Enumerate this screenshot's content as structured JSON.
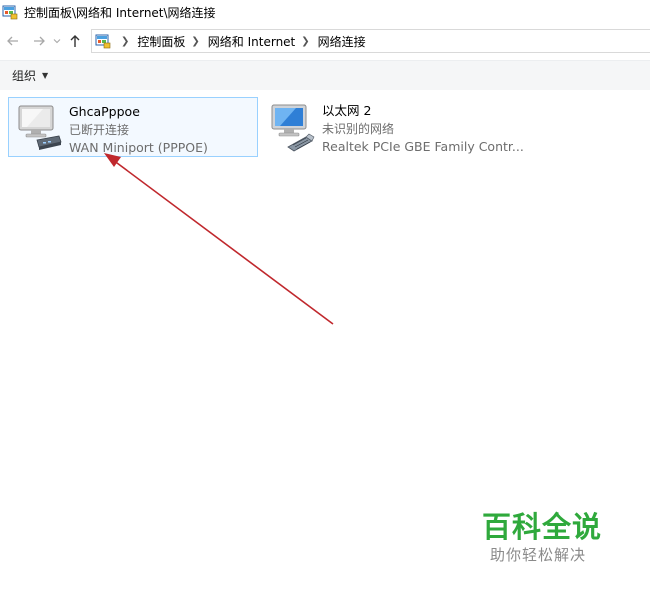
{
  "window": {
    "title": "控制面板\\网络和 Internet\\网络连接"
  },
  "nav": {
    "back_icon": "arrow-left-icon",
    "forward_icon": "arrow-right-icon",
    "recent_icon": "chevron-down-icon",
    "up_icon": "arrow-up-icon",
    "breadcrumbs": [
      "控制面板",
      "网络和 Internet",
      "网络连接"
    ]
  },
  "toolbar": {
    "organize_label": "组织"
  },
  "connections": [
    {
      "name": "GhcaPppoe",
      "status": "已断开连接",
      "device": "WAN Miniport (PPPOE)",
      "selected": true,
      "icon": "dialup-connection-icon"
    },
    {
      "name": "以太网 2",
      "status": "未识别的网络",
      "device": "Realtek PCIe GBE Family Contr...",
      "selected": false,
      "icon": "ethernet-connection-icon"
    }
  ],
  "watermark": {
    "title": "百科全说",
    "subtitle": "助你轻松解决"
  },
  "colors": {
    "selection_border": "#99d1ff",
    "annotation_arrow": "#c0282d",
    "watermark_green": "#2fa93c"
  }
}
